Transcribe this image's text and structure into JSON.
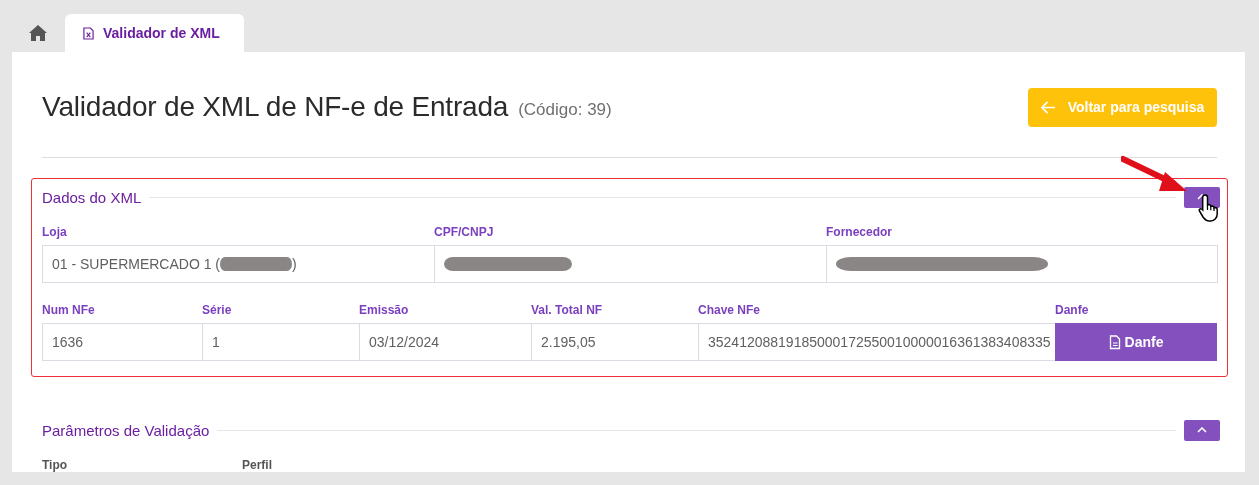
{
  "tabs": [
    {
      "kind": "home",
      "selected": false
    },
    {
      "kind": "page",
      "label": "Validador de XML",
      "selected": true
    }
  ],
  "header": {
    "title": "Validador de XML de NF-e de Entrada",
    "code": "(Código: 39)",
    "back_button": "Voltar para pesquisa"
  },
  "sections": [
    {
      "title": "Dados do XML",
      "expanded": true,
      "highlighted": true,
      "field_groups": [
        {
          "fields": [
            {
              "label": "Loja",
              "value": "01 - SUPERMERCADO 1 (",
              "value_after": ")",
              "redacted": true,
              "kind": "field"
            },
            {
              "label": "CPF/CNPJ",
              "redacted": true,
              "kind": "field"
            },
            {
              "label": "Fornecedor",
              "redacted": true,
              "kind": "field"
            }
          ]
        },
        {
          "fields": [
            {
              "label": "Num NFe",
              "value": "1636",
              "kind": "field"
            },
            {
              "label": "Série",
              "value": "1",
              "kind": "field"
            },
            {
              "label": "Emissão",
              "value": "03/12/2024",
              "kind": "field"
            },
            {
              "label": "Val. Total NF",
              "value": "2.195,05",
              "kind": "field"
            },
            {
              "label": "Chave NFe",
              "value": "35241208819185000172550010000016361383408335",
              "kind": "field"
            },
            {
              "label": "Danfe",
              "value": "Danfe",
              "kind": "button"
            }
          ]
        }
      ]
    },
    {
      "title": "Parâmetros de Validação",
      "expanded": true,
      "highlighted": false,
      "field_groups": [
        {
          "fields": [
            {
              "label": "Tipo",
              "kind": "label"
            },
            {
              "label": "Perfil",
              "kind": "label"
            }
          ]
        }
      ]
    }
  ]
}
